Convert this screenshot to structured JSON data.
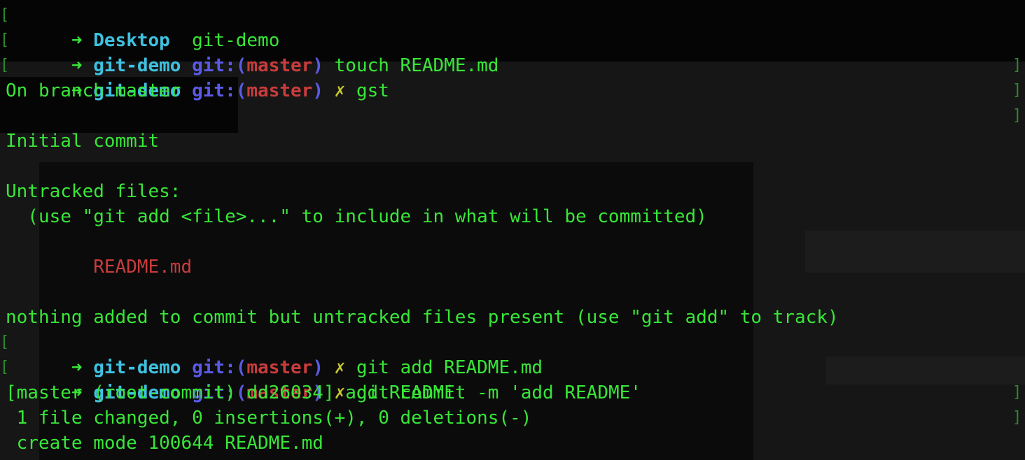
{
  "prompt": {
    "arrow": "➜",
    "git_label": "git:",
    "open_paren": "(",
    "close_paren": ")",
    "dirty_mark": "✗",
    "bracket_left": "[",
    "bracket_right": "]"
  },
  "lines": [
    {
      "dir": "Desktop",
      "command": "git-demo"
    },
    {
      "dir": "git-demo",
      "branch": "master",
      "command": "touch README.md"
    },
    {
      "dir": "git-demo",
      "branch": "master",
      "command": "gst"
    },
    {
      "output": "On branch master"
    },
    {
      "output": ""
    },
    {
      "output": "Initial commit"
    },
    {
      "output": ""
    },
    {
      "output": "Untracked files:"
    },
    {
      "output": "  (use \"git add <file>...\" to include in what will be committed)"
    },
    {
      "output": ""
    },
    {
      "output": "        ",
      "untracked_file": "README.md"
    },
    {
      "output": ""
    },
    {
      "output": "nothing added to commit but untracked files present (use \"git add\" to track)"
    },
    {
      "dir": "git-demo",
      "branch": "master",
      "command": "git add README.md"
    },
    {
      "dir": "git-demo",
      "branch": "master",
      "command": "git commit -m 'add README'"
    },
    {
      "output": "[master (root-commit) dd26034] add README"
    },
    {
      "output": " 1 file changed, 0 insertions(+), 0 deletions(-)"
    },
    {
      "output": " create mode 100644 README.md"
    }
  ],
  "colors": {
    "background": "#050505",
    "output_green": "#38e638",
    "dir_cyan": "#3fc1e0",
    "git_blue": "#5a5ae6",
    "branch_red": "#c83c3c",
    "dirty_yellow": "#c8c832"
  }
}
